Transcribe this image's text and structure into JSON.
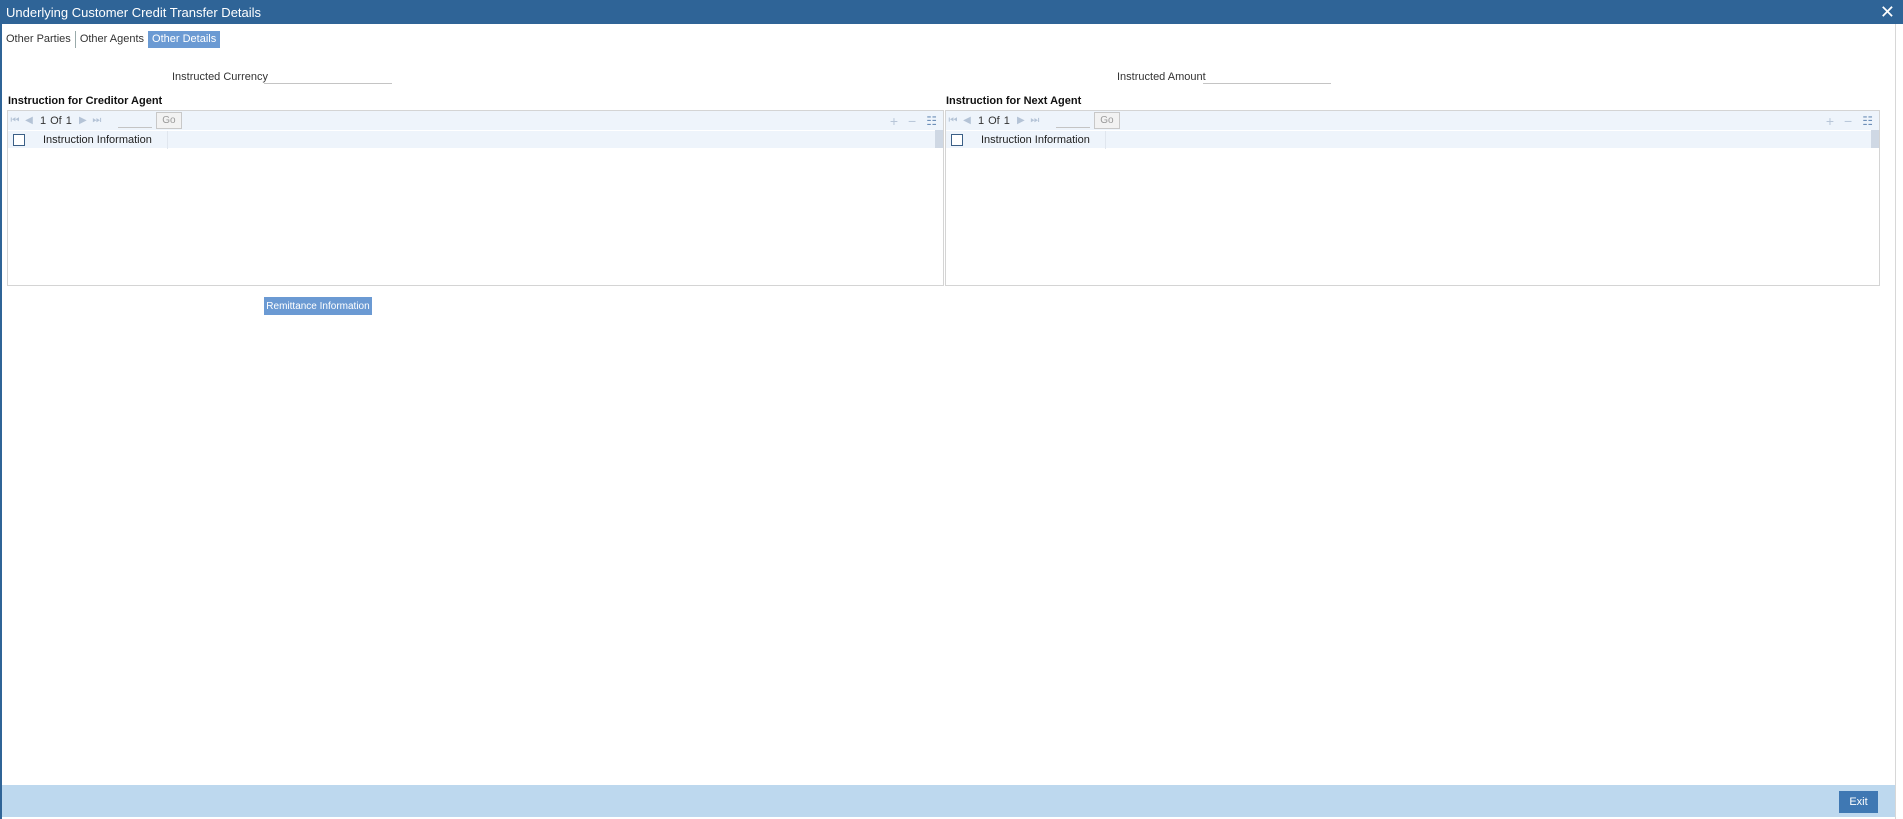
{
  "window": {
    "title": "Underlying Customer Credit Transfer Details",
    "close_label": "✕"
  },
  "tabs": [
    {
      "label": "Other Parties"
    },
    {
      "label": "Other Agents"
    },
    {
      "label": "Other Details"
    }
  ],
  "fields": {
    "instructed_currency": {
      "label": "Instructed Currency",
      "value": ""
    },
    "instructed_amount": {
      "label": "Instructed Amount",
      "value": ""
    }
  },
  "creditor_agent": {
    "title": "Instruction for Creditor Agent",
    "pager": {
      "current": "1",
      "of": "Of",
      "total": "1",
      "go_label": "Go"
    },
    "column": "Instruction Information"
  },
  "next_agent": {
    "title": "Instruction for Next Agent",
    "pager": {
      "current": "1",
      "of": "Of",
      "total": "1",
      "go_label": "Go"
    },
    "column": "Instruction Information"
  },
  "buttons": {
    "remittance": "Remittance Information",
    "exit": "Exit"
  },
  "icons": {
    "first": "⏮",
    "prev": "◀",
    "next": "▶",
    "last": "⏭",
    "add": "+",
    "remove": "−",
    "list": "☷"
  }
}
